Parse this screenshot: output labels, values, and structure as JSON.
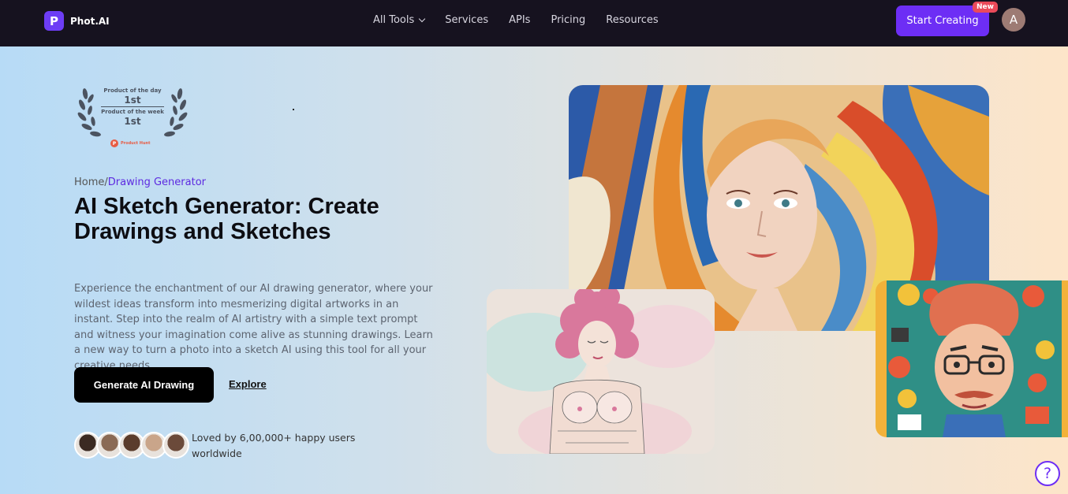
{
  "nav": {
    "logo_letter": "P",
    "logo_text": "Phot.AI",
    "items": [
      {
        "label": "All Tools"
      },
      {
        "label": "Services"
      },
      {
        "label": "APIs"
      },
      {
        "label": "Pricing"
      },
      {
        "label": "Resources"
      }
    ],
    "cta_label": "Start Creating",
    "new_badge": "New",
    "avatar_initial": "A"
  },
  "award": {
    "line1_small": "Product of the day",
    "line1_big": "1st",
    "line2_small": "Product of the week",
    "line2_big": "1st",
    "source_letter": "P",
    "source": "Product Hunt"
  },
  "breadcrumb": {
    "home": "Home",
    "separator": "/",
    "current": "Drawing Generator"
  },
  "hero": {
    "title": "AI Sketch Generator: Create Drawings and Sketches",
    "description": "Experience the enchantment of our AI drawing generator, where your wildest ideas transform into mesmerizing digital artworks in an instant. Step into the realm of AI artistry with a simple text prompt and witness your imagination come alive as stunning drawings. Learn a new way to turn a photo into a sketch AI using this tool for all your creative needs.",
    "primary_button": "Generate AI Drawing",
    "secondary_link": "Explore"
  },
  "social_proof": {
    "text": "Loved by 6,00,000+ happy users worldwide",
    "avatar_colors": [
      "#3b2a22",
      "#8a6a55",
      "#5a3c2c",
      "#c9a58a",
      "#6b4a3a"
    ]
  },
  "help_icon": "?"
}
